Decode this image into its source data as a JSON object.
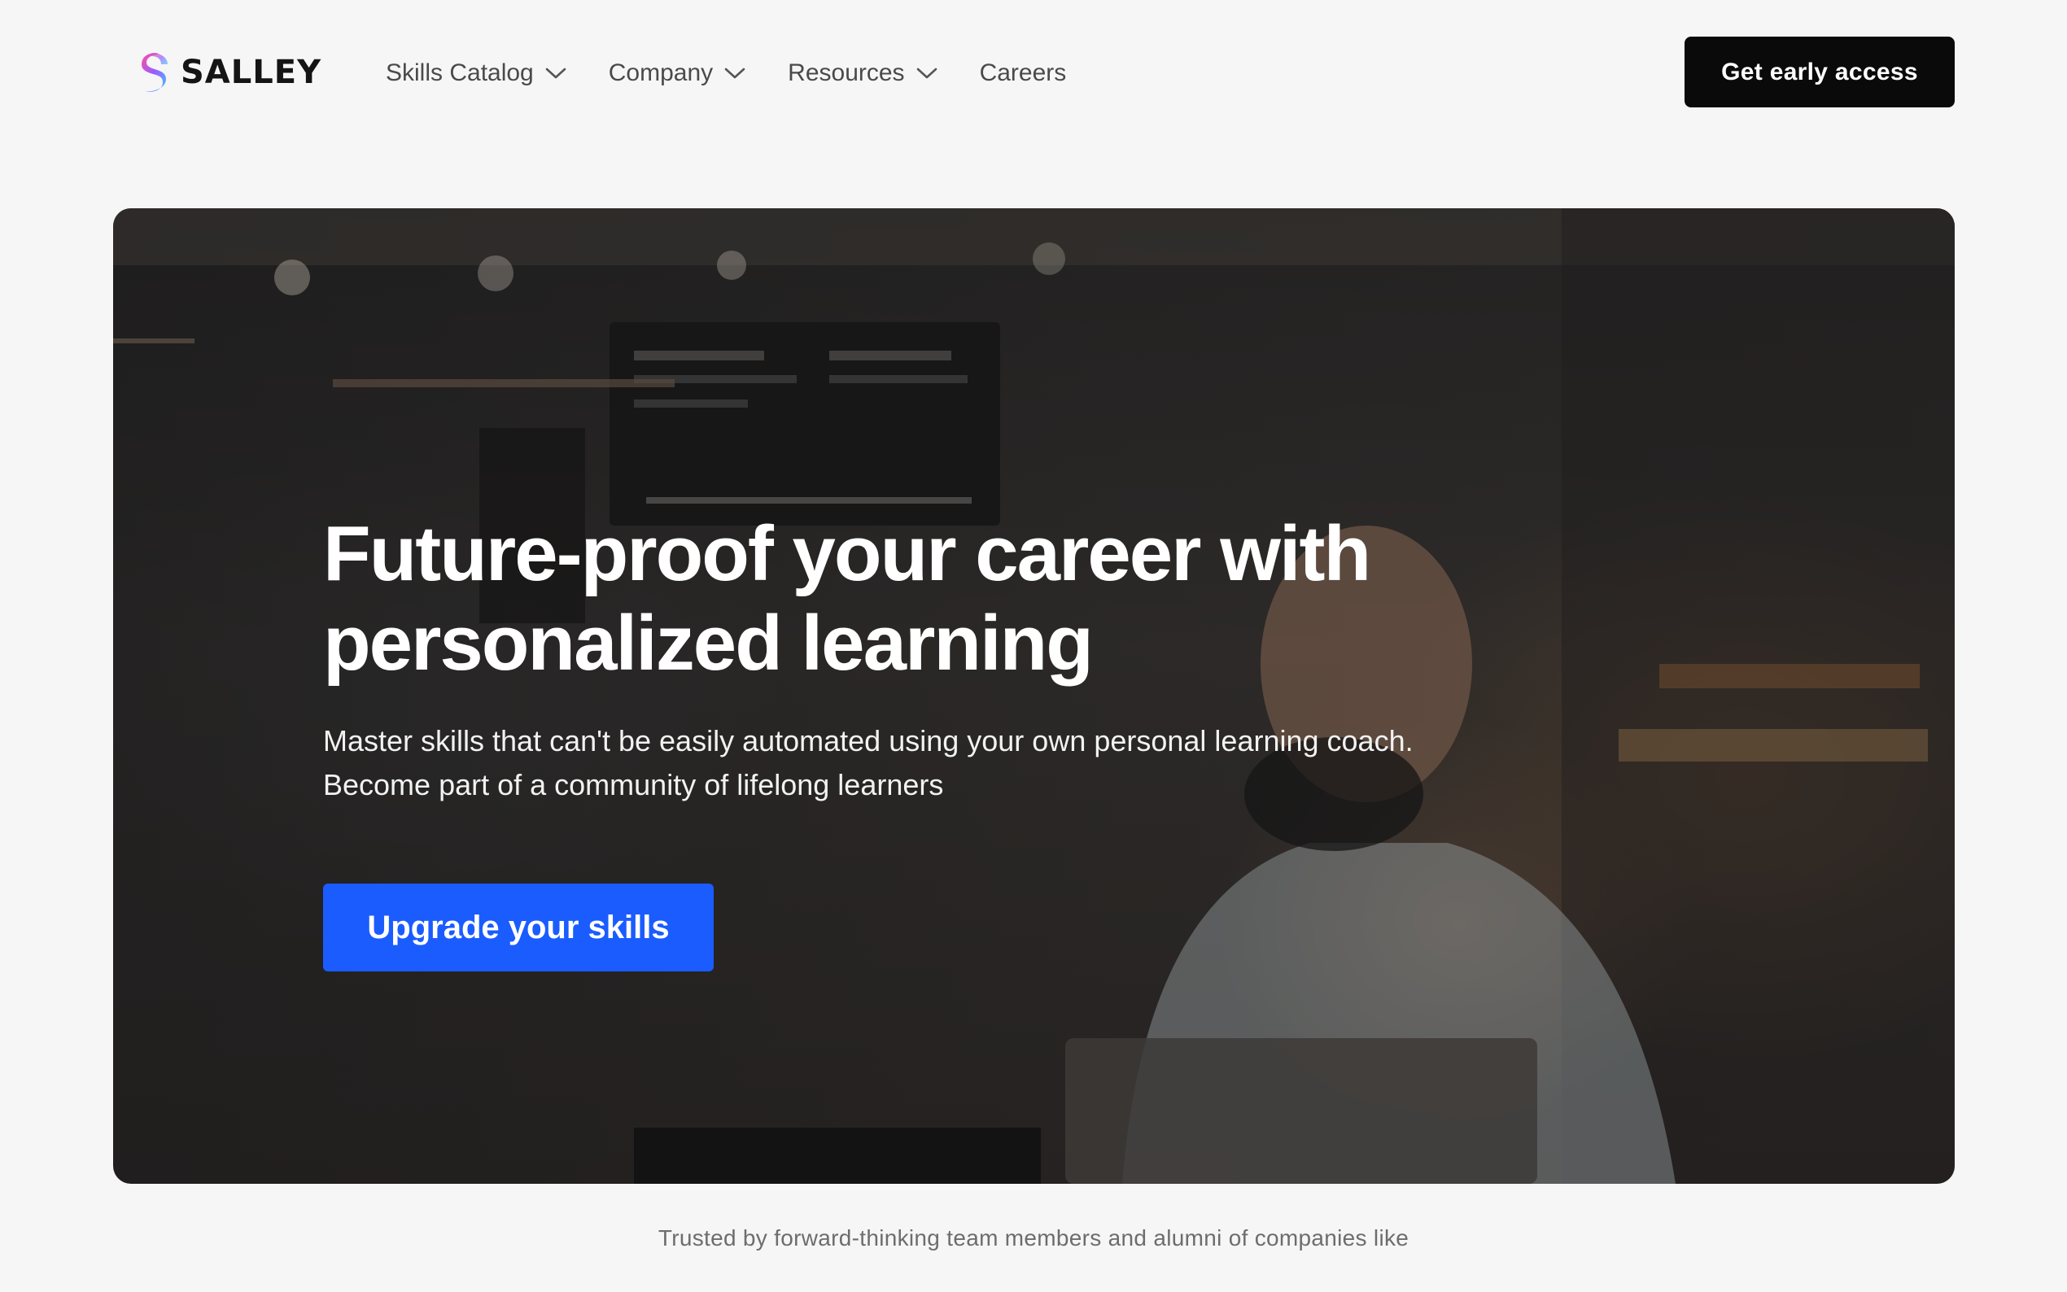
{
  "brand": {
    "name": "SALLEY",
    "logo_gradient": [
      "#ff4fa3",
      "#9b5cff",
      "#3fc6ff"
    ]
  },
  "nav": {
    "items": [
      {
        "label": "Skills Catalog",
        "has_dropdown": true,
        "icon": "chevron-down-icon"
      },
      {
        "label": "Company",
        "has_dropdown": true,
        "icon": "chevron-down-icon"
      },
      {
        "label": "Resources",
        "has_dropdown": true,
        "icon": "chevron-down-icon"
      },
      {
        "label": "Careers",
        "has_dropdown": false
      }
    ],
    "cta_label": "Get early access"
  },
  "hero": {
    "title_line1": "Future-proof your career with",
    "title_line2": "personalized learning",
    "subtitle_line1": "Master skills that can't be easily automated using your own personal learning coach.",
    "subtitle_line2": "Become part of a community of lifelong learners",
    "cta_label": "Upgrade your skills",
    "cta_color": "#1b5cff"
  },
  "trusted_text": "Trusted by forward-thinking team members and alumni of companies like",
  "colors": {
    "page_bg": "#f6f6f6",
    "nav_cta_bg": "#0a0a0a",
    "nav_text": "#4a4a4a"
  }
}
